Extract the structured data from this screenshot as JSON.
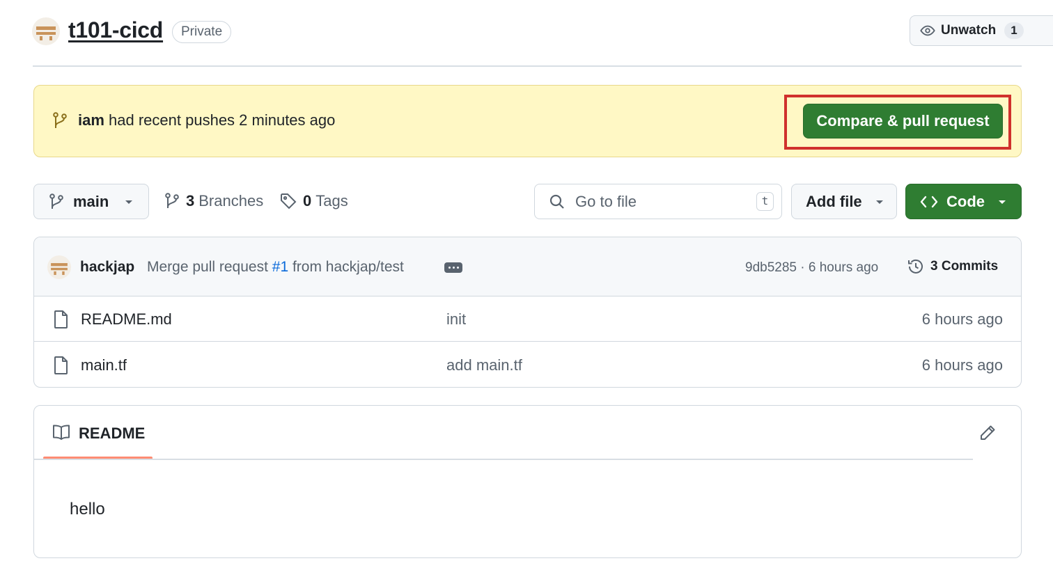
{
  "repo": {
    "name": "t101-cicd",
    "visibility": "Private",
    "watch_label": "Unwatch",
    "watch_count": "1"
  },
  "banner": {
    "user": "iam",
    "message": " had recent pushes 2 minutes ago",
    "compare_label": "Compare & pull request"
  },
  "toolbar": {
    "branch": "main",
    "branches_count": "3",
    "branches_label": "Branches",
    "tags_count": "0",
    "tags_label": "Tags",
    "search_placeholder": "Go to file",
    "search_shortcut": "t",
    "add_file_label": "Add file",
    "code_label": "Code"
  },
  "latest_commit": {
    "author": "hackjap",
    "message_prefix": "Merge pull request ",
    "pr_ref": "#1",
    "message_suffix": " from hackjap/test",
    "meta": "9db5285 · 6 hours ago",
    "commits_label": "3 Commits"
  },
  "files": [
    {
      "name": "README.md",
      "message": "init",
      "age": "6 hours ago"
    },
    {
      "name": "main.tf",
      "message": "add main.tf",
      "age": "6 hours ago"
    }
  ],
  "readme": {
    "tab_label": "README",
    "content": "hello"
  },
  "colors": {
    "primary_button": "#2f7d32",
    "banner_background": "#fff8c5",
    "highlight_border": "#d0312d",
    "link": "#0969da",
    "tab_underline": "#fd8c73"
  }
}
